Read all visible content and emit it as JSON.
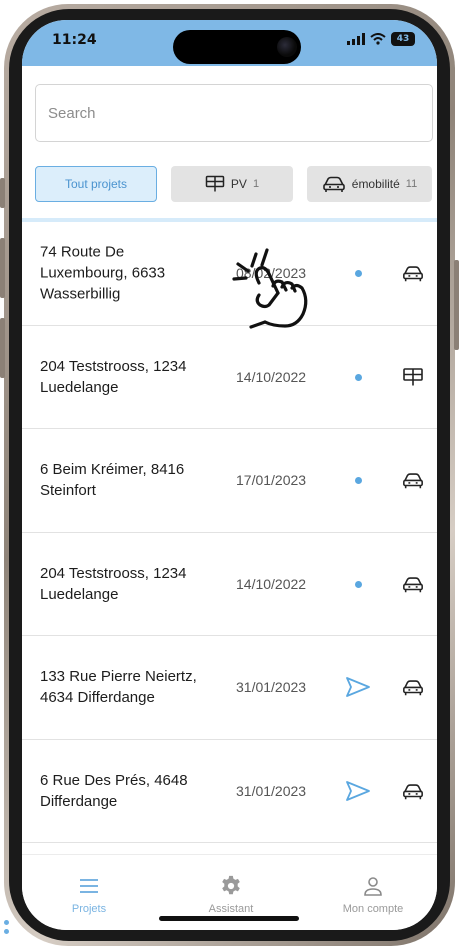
{
  "status_bar": {
    "time": "11:24",
    "battery": "43"
  },
  "search": {
    "placeholder": "Search"
  },
  "filters": [
    {
      "label": "Tout projets",
      "count": "",
      "icon": "",
      "active": true
    },
    {
      "label": "PV",
      "count": "1",
      "icon": "solar-panel-icon",
      "active": false
    },
    {
      "label": "émobilité",
      "count": "11",
      "icon": "car-icon",
      "active": false
    }
  ],
  "projects": [
    {
      "address": "74 Route De Luxembourg, 6633 Wasserbillig",
      "date": "08/02/2023",
      "status": "dot",
      "type": "car"
    },
    {
      "address": "204 Teststrooss, 1234 Luedelange",
      "date": "14/10/2022",
      "status": "dot",
      "type": "solar"
    },
    {
      "address": "6 Beim Kréimer, 8416 Steinfort",
      "date": "17/01/2023",
      "status": "dot",
      "type": "car"
    },
    {
      "address": "204 Teststrooss, 1234 Luedelange",
      "date": "14/10/2022",
      "status": "dot",
      "type": "car"
    },
    {
      "address": "133 Rue Pierre Neiertz, 4634 Differdange",
      "date": "31/01/2023",
      "status": "sent",
      "type": "car"
    },
    {
      "address": "6 Rue Des Prés, 4648 Differdange",
      "date": "31/01/2023",
      "status": "sent",
      "type": "car"
    }
  ],
  "bottom_nav": [
    {
      "label": "Projets",
      "icon": "menu-icon",
      "active": true
    },
    {
      "label": "Assistant",
      "icon": "gear-icon",
      "active": false
    },
    {
      "label": "Mon compte",
      "icon": "user-icon",
      "active": false
    }
  ],
  "colors": {
    "accent": "#5aa7e0",
    "status_bar": "#7fb8e6",
    "active_chip_bg": "#dceefb"
  }
}
